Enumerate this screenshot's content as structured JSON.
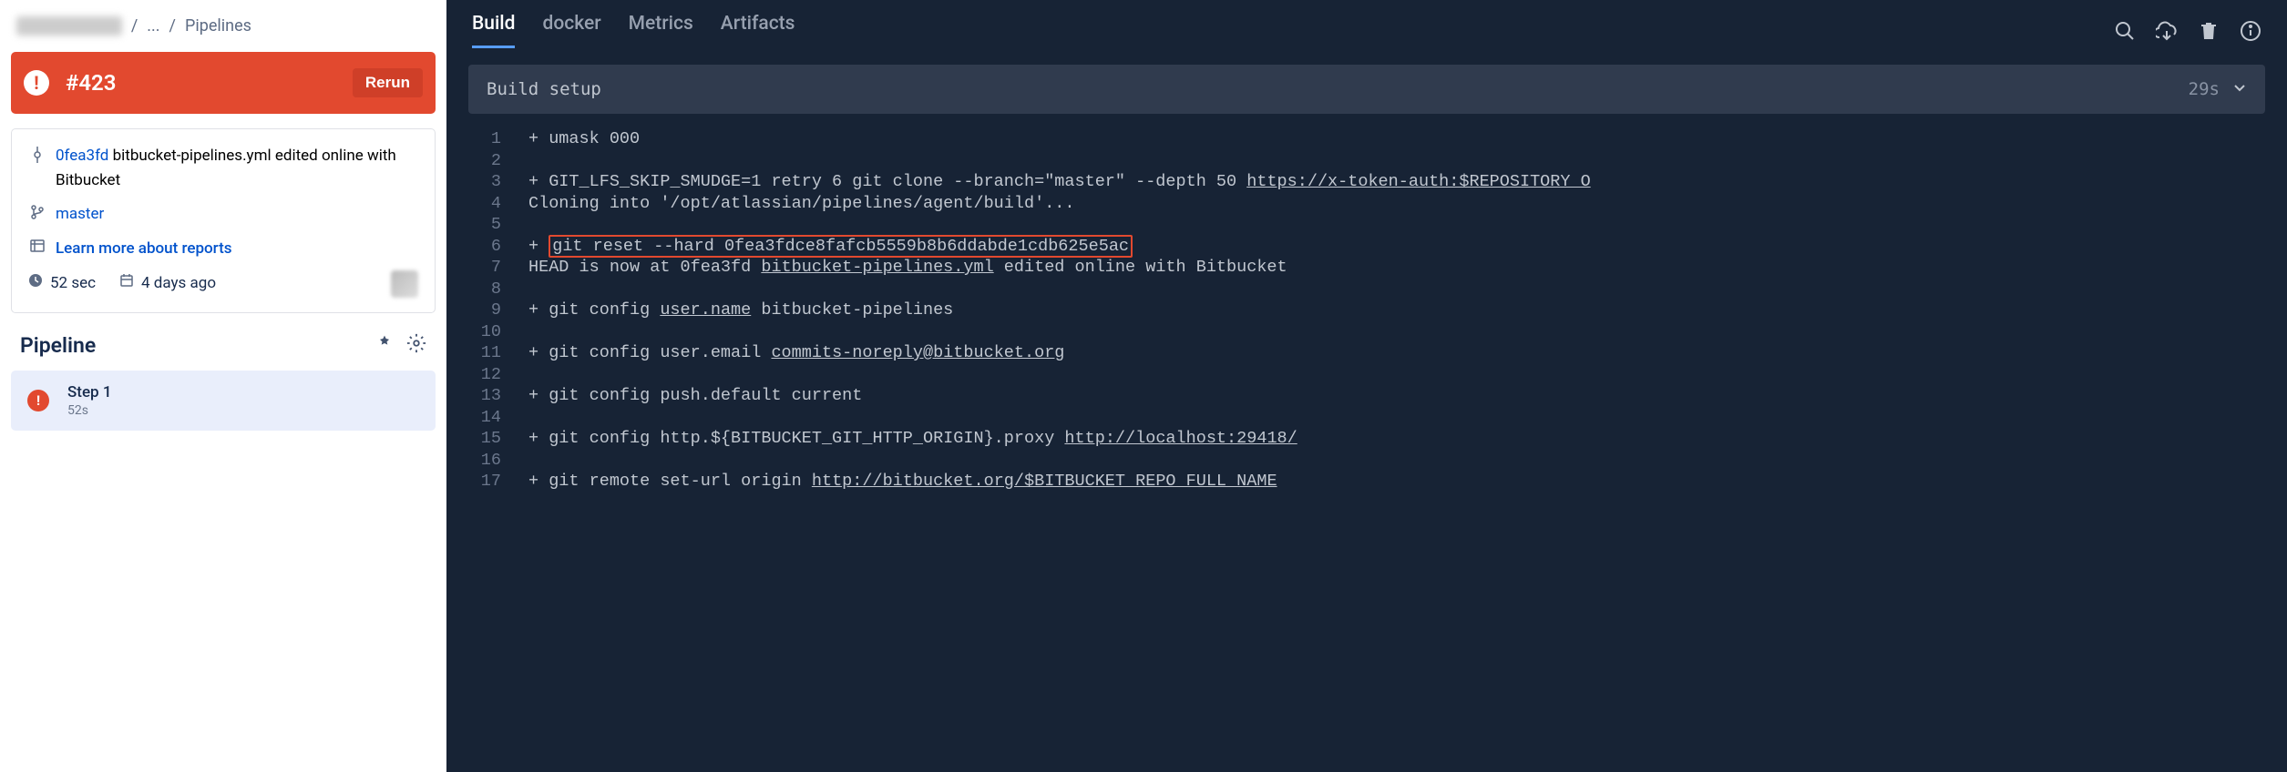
{
  "breadcrumb": {
    "ellipsis": "...",
    "current": "Pipelines"
  },
  "banner": {
    "run_number": "#423",
    "rerun": "Rerun"
  },
  "commit": {
    "hash": "0fea3fd",
    "message": "bitbucket-pipelines.yml edited online with Bitbucket",
    "branch": "master",
    "learn": "Learn more about reports",
    "duration": "52 sec",
    "when": "4 days ago"
  },
  "pipeline": {
    "title": "Pipeline",
    "step_name": "Step 1",
    "step_time": "52s"
  },
  "tabs": [
    "Build",
    "docker",
    "Metrics",
    "Artifacts"
  ],
  "active_tab": 0,
  "stage": {
    "name": "Build setup",
    "duration": "29s"
  },
  "log": [
    {
      "n": 1,
      "t": "+ umask 000"
    },
    {
      "n": 2,
      "t": ""
    },
    {
      "n": 3,
      "t": "+ GIT_LFS_SKIP_SMUDGE=1 retry 6 git clone --branch=\"master\" --depth 50 ",
      "u": "https://x-token-auth:$REPOSITORY_O"
    },
    {
      "n": 4,
      "t": "Cloning into '/opt/atlassian/pipelines/agent/build'..."
    },
    {
      "n": 5,
      "t": ""
    },
    {
      "n": 6,
      "pre": "+ ",
      "hl": "git reset --hard 0fea3fdce8fafcb5559b8b6ddabde1cdb625e5ac"
    },
    {
      "n": 7,
      "t": "HEAD is now at 0fea3fd ",
      "u": "bitbucket-pipelines.yml",
      "post": " edited online with Bitbucket"
    },
    {
      "n": 8,
      "t": ""
    },
    {
      "n": 9,
      "t": "+ git config ",
      "u": "user.name",
      "post": " bitbucket-pipelines"
    },
    {
      "n": 10,
      "t": ""
    },
    {
      "n": 11,
      "t": "+ git config user.email ",
      "u": "commits-noreply@bitbucket.org"
    },
    {
      "n": 12,
      "t": ""
    },
    {
      "n": 13,
      "t": "+ git config push.default current"
    },
    {
      "n": 14,
      "t": ""
    },
    {
      "n": 15,
      "t": "+ git config http.${BITBUCKET_GIT_HTTP_ORIGIN}.proxy ",
      "u": "http://localhost:29418/"
    },
    {
      "n": 16,
      "t": ""
    },
    {
      "n": 17,
      "t": "+ git remote set-url origin ",
      "u": "http://bitbucket.org/$BITBUCKET_REPO_FULL_NAME"
    }
  ]
}
